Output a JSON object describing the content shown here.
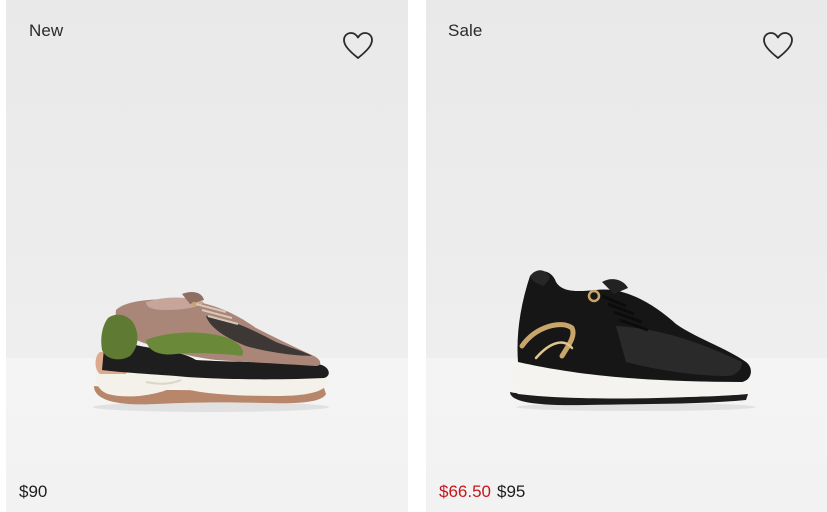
{
  "products": [
    {
      "badge": "New",
      "price": "$90",
      "wishlist_icon": "heart-outline-icon"
    },
    {
      "badge": "Sale",
      "sale_price": "$66.50",
      "price": "$95",
      "wishlist_icon": "heart-outline-icon"
    }
  ],
  "colors": {
    "sale_red": "#c4161c",
    "text": "#1d1d1d",
    "background": "#ececec"
  }
}
